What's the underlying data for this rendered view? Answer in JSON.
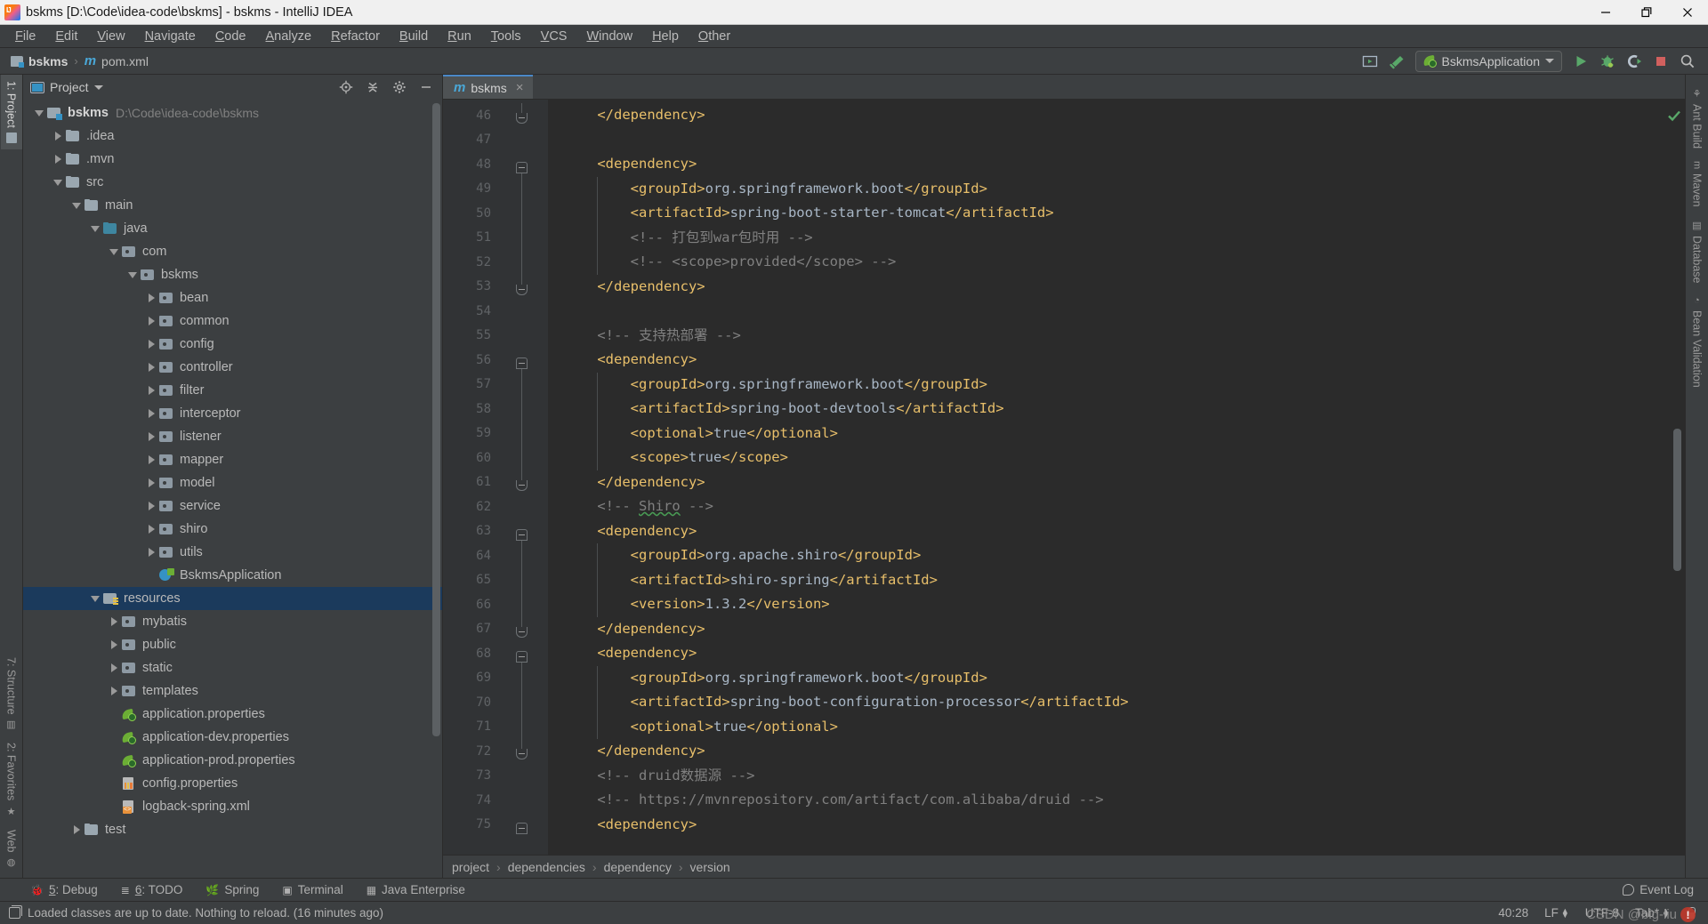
{
  "window": {
    "title": "bskms [D:\\Code\\idea-code\\bskms] - bskms - IntelliJ IDEA",
    "app_icon": "intellij-idea-icon",
    "minimize": "minimize-icon",
    "maximize": "restore-icon",
    "close": "close-icon"
  },
  "menubar": {
    "items": [
      {
        "label": "File"
      },
      {
        "label": "Edit"
      },
      {
        "label": "View"
      },
      {
        "label": "Navigate"
      },
      {
        "label": "Code"
      },
      {
        "label": "Analyze"
      },
      {
        "label": "Refactor"
      },
      {
        "label": "Build"
      },
      {
        "label": "Run"
      },
      {
        "label": "Tools"
      },
      {
        "label": "VCS"
      },
      {
        "label": "Window"
      },
      {
        "label": "Help"
      },
      {
        "label": "Other"
      }
    ]
  },
  "navbar": {
    "crumbs": [
      {
        "label": "bskms",
        "icon": "module-folder-icon"
      },
      {
        "label": "pom.xml",
        "icon": "maven-m-icon"
      }
    ],
    "separator": "›",
    "right_tools": [
      {
        "name": "run-anything-icon",
        "title": "Run Anything"
      },
      {
        "name": "hammer-build-icon",
        "title": "Build Project"
      }
    ],
    "run_config": {
      "label": "BskmsApplication",
      "icon": "spring-boot-leaf-icon",
      "dropdown": "chevron-down-icon"
    },
    "run_buttons": [
      {
        "name": "run-button",
        "glyph": "▶",
        "color": "#59a869"
      },
      {
        "name": "debug-button",
        "glyph": "bug",
        "color": "#59a869"
      },
      {
        "name": "run-coverage-button",
        "glyph": "coverage",
        "color": "#a9b7c6"
      },
      {
        "name": "stop-button",
        "glyph": "■",
        "color": "#d1605e"
      }
    ],
    "search_icon": "magnifier-icon"
  },
  "left_rail": {
    "top": [
      {
        "label": "1: Project",
        "icon": "project-folder-icon",
        "active": true
      }
    ],
    "bottom": [
      {
        "label": "7: Structure",
        "icon": "structure-icon"
      },
      {
        "label": "2: Favorites",
        "icon": "star-icon"
      },
      {
        "label": "Web",
        "icon": "web-globe-icon"
      }
    ]
  },
  "right_rail": {
    "items": [
      {
        "label": "Ant Build",
        "icon": "ant-icon"
      },
      {
        "label": "Maven",
        "icon": "maven-m-icon"
      },
      {
        "label": "Database",
        "icon": "database-icon"
      },
      {
        "label": "Bean Validation",
        "icon": "bean-validation-icon"
      }
    ]
  },
  "project_panel": {
    "title": "Project",
    "title_dropdown": "chevron-down-icon",
    "toolbar": [
      {
        "name": "locate-target-icon"
      },
      {
        "name": "collapse-all-icon"
      },
      {
        "name": "settings-gear-icon"
      },
      {
        "name": "hide-panel-icon"
      }
    ],
    "tree": [
      {
        "label": "bskms",
        "path": "D:\\Code\\idea-code\\bskms",
        "indent": 0,
        "arrow": "open",
        "icon": "module",
        "bold": true
      },
      {
        "label": ".idea",
        "indent": 1,
        "arrow": "closed",
        "icon": "folder"
      },
      {
        "label": ".mvn",
        "indent": 1,
        "arrow": "closed",
        "icon": "folder"
      },
      {
        "label": "src",
        "indent": 1,
        "arrow": "open",
        "icon": "folder"
      },
      {
        "label": "main",
        "indent": 2,
        "arrow": "open",
        "icon": "folder"
      },
      {
        "label": "java",
        "indent": 3,
        "arrow": "open",
        "icon": "folder-src"
      },
      {
        "label": "com",
        "indent": 4,
        "arrow": "open",
        "icon": "pkg"
      },
      {
        "label": "bskms",
        "indent": 5,
        "arrow": "open",
        "icon": "pkg"
      },
      {
        "label": "bean",
        "indent": 6,
        "arrow": "closed",
        "icon": "pkg"
      },
      {
        "label": "common",
        "indent": 6,
        "arrow": "closed",
        "icon": "pkg"
      },
      {
        "label": "config",
        "indent": 6,
        "arrow": "closed",
        "icon": "pkg"
      },
      {
        "label": "controller",
        "indent": 6,
        "arrow": "closed",
        "icon": "pkg"
      },
      {
        "label": "filter",
        "indent": 6,
        "arrow": "closed",
        "icon": "pkg"
      },
      {
        "label": "interceptor",
        "indent": 6,
        "arrow": "closed",
        "icon": "pkg"
      },
      {
        "label": "listener",
        "indent": 6,
        "arrow": "closed",
        "icon": "pkg"
      },
      {
        "label": "mapper",
        "indent": 6,
        "arrow": "closed",
        "icon": "pkg"
      },
      {
        "label": "model",
        "indent": 6,
        "arrow": "closed",
        "icon": "pkg"
      },
      {
        "label": "service",
        "indent": 6,
        "arrow": "closed",
        "icon": "pkg"
      },
      {
        "label": "shiro",
        "indent": 6,
        "arrow": "closed",
        "icon": "pkg"
      },
      {
        "label": "utils",
        "indent": 6,
        "arrow": "closed",
        "icon": "pkg"
      },
      {
        "label": "BskmsApplication",
        "indent": 6,
        "arrow": "none",
        "icon": "springclass"
      },
      {
        "label": "resources",
        "indent": 3,
        "arrow": "open",
        "icon": "res",
        "selected": true
      },
      {
        "label": "mybatis",
        "indent": 4,
        "arrow": "closed",
        "icon": "pkg"
      },
      {
        "label": "public",
        "indent": 4,
        "arrow": "closed",
        "icon": "pkg"
      },
      {
        "label": "static",
        "indent": 4,
        "arrow": "closed",
        "icon": "pkg"
      },
      {
        "label": "templates",
        "indent": 4,
        "arrow": "closed",
        "icon": "pkg"
      },
      {
        "label": "application.properties",
        "indent": 4,
        "arrow": "none",
        "icon": "spring"
      },
      {
        "label": "application-dev.properties",
        "indent": 4,
        "arrow": "none",
        "icon": "spring"
      },
      {
        "label": "application-prod.properties",
        "indent": 4,
        "arrow": "none",
        "icon": "spring"
      },
      {
        "label": "config.properties",
        "indent": 4,
        "arrow": "none",
        "icon": "props"
      },
      {
        "label": "logback-spring.xml",
        "indent": 4,
        "arrow": "none",
        "icon": "xml"
      },
      {
        "label": "test",
        "indent": 2,
        "arrow": "closed",
        "icon": "folder"
      }
    ]
  },
  "editor": {
    "tab": {
      "label": "bskms",
      "icon": "maven-m-icon",
      "close": "close-icon"
    },
    "first_line_number": 46,
    "lines": [
      {
        "n": 46,
        "fold": "bot",
        "segments": [
          {
            "t": "tag",
            "s": "    </dependency>"
          }
        ]
      },
      {
        "n": 47,
        "segments": []
      },
      {
        "n": 48,
        "fold": "top",
        "segments": [
          {
            "t": "tag",
            "s": "    <dependency>"
          }
        ]
      },
      {
        "n": 49,
        "segments": [
          {
            "t": "tag",
            "s": "        <groupId>"
          },
          {
            "t": "txt",
            "s": "org.springframework.boot"
          },
          {
            "t": "tag",
            "s": "</groupId>"
          }
        ]
      },
      {
        "n": 50,
        "segments": [
          {
            "t": "tag",
            "s": "        <artifactId>"
          },
          {
            "t": "txt",
            "s": "spring-boot-starter-tomcat"
          },
          {
            "t": "tag",
            "s": "</artifactId>"
          }
        ]
      },
      {
        "n": 51,
        "segments": [
          {
            "t": "cmt",
            "s": "        <!-- 打包到war包时用 -->"
          }
        ]
      },
      {
        "n": 52,
        "segments": [
          {
            "t": "cmt",
            "s": "        <!-- <scope>provided</scope> -->"
          }
        ]
      },
      {
        "n": 53,
        "fold": "bot",
        "segments": [
          {
            "t": "tag",
            "s": "    </dependency>"
          }
        ]
      },
      {
        "n": 54,
        "segments": []
      },
      {
        "n": 55,
        "segments": [
          {
            "t": "cmt",
            "s": "    <!-- 支持热部署 -->"
          }
        ]
      },
      {
        "n": 56,
        "fold": "top",
        "segments": [
          {
            "t": "tag",
            "s": "    <dependency>"
          }
        ]
      },
      {
        "n": 57,
        "segments": [
          {
            "t": "tag",
            "s": "        <groupId>"
          },
          {
            "t": "txt",
            "s": "org.springframework.boot"
          },
          {
            "t": "tag",
            "s": "</groupId>"
          }
        ]
      },
      {
        "n": 58,
        "segments": [
          {
            "t": "tag",
            "s": "        <artifactId>"
          },
          {
            "t": "txt",
            "s": "spring-boot-devtools"
          },
          {
            "t": "tag",
            "s": "</artifactId>"
          }
        ]
      },
      {
        "n": 59,
        "segments": [
          {
            "t": "tag",
            "s": "        <optional>"
          },
          {
            "t": "txt",
            "s": "true"
          },
          {
            "t": "tag",
            "s": "</optional>"
          }
        ]
      },
      {
        "n": 60,
        "segments": [
          {
            "t": "tag",
            "s": "        <scope>"
          },
          {
            "t": "txt",
            "s": "true"
          },
          {
            "t": "tag",
            "s": "</scope>"
          }
        ]
      },
      {
        "n": 61,
        "fold": "bot",
        "segments": [
          {
            "t": "tag",
            "s": "    </dependency>"
          }
        ]
      },
      {
        "n": 62,
        "segments": [
          {
            "t": "cmt",
            "s": "    <!-- "
          },
          {
            "t": "typo",
            "s": "Shiro"
          },
          {
            "t": "cmt",
            "s": " -->"
          }
        ]
      },
      {
        "n": 63,
        "fold": "top",
        "segments": [
          {
            "t": "tag",
            "s": "    <dependency>"
          }
        ]
      },
      {
        "n": 64,
        "segments": [
          {
            "t": "tag",
            "s": "        <groupId>"
          },
          {
            "t": "txt",
            "s": "org.apache.shiro"
          },
          {
            "t": "tag",
            "s": "</groupId>"
          }
        ]
      },
      {
        "n": 65,
        "segments": [
          {
            "t": "tag",
            "s": "        <artifactId>"
          },
          {
            "t": "txt",
            "s": "shiro-spring"
          },
          {
            "t": "tag",
            "s": "</artifactId>"
          }
        ]
      },
      {
        "n": 66,
        "segments": [
          {
            "t": "tag",
            "s": "        <version>"
          },
          {
            "t": "txt",
            "s": "1.3.2"
          },
          {
            "t": "tag",
            "s": "</version>"
          }
        ]
      },
      {
        "n": 67,
        "fold": "bot",
        "segments": [
          {
            "t": "tag",
            "s": "    </dependency>"
          }
        ]
      },
      {
        "n": 68,
        "fold": "top",
        "segments": [
          {
            "t": "tag",
            "s": "    <dependency>"
          }
        ]
      },
      {
        "n": 69,
        "segments": [
          {
            "t": "tag",
            "s": "        <groupId>"
          },
          {
            "t": "txt",
            "s": "org.springframework.boot"
          },
          {
            "t": "tag",
            "s": "</groupId>"
          }
        ]
      },
      {
        "n": 70,
        "segments": [
          {
            "t": "tag",
            "s": "        <artifactId>"
          },
          {
            "t": "txt",
            "s": "spring-boot-configuration-processor"
          },
          {
            "t": "tag",
            "s": "</artifactId>"
          }
        ]
      },
      {
        "n": 71,
        "segments": [
          {
            "t": "tag",
            "s": "        <optional>"
          },
          {
            "t": "txt",
            "s": "true"
          },
          {
            "t": "tag",
            "s": "</optional>"
          }
        ]
      },
      {
        "n": 72,
        "fold": "bot",
        "segments": [
          {
            "t": "tag",
            "s": "    </dependency>"
          }
        ]
      },
      {
        "n": 73,
        "segments": [
          {
            "t": "cmt",
            "s": "    <!-- druid数据源 -->"
          }
        ]
      },
      {
        "n": 74,
        "segments": [
          {
            "t": "cmt",
            "s": "    <!-- https://mvnrepository.com/artifact/com.alibaba/druid -->"
          }
        ]
      },
      {
        "n": 75,
        "fold": "top",
        "segments": [
          {
            "t": "tag",
            "s": "    <dependency>"
          }
        ]
      }
    ],
    "inspection_status": {
      "icon": "inspection-ok-check-icon",
      "color": "#59a869"
    }
  },
  "breadcrumb": {
    "items": [
      "project",
      "dependencies",
      "dependency",
      "version"
    ],
    "separator": "›"
  },
  "bottom_bar": {
    "items": [
      {
        "label": "5: Debug",
        "mnemonic": "5",
        "icon": "bug-icon"
      },
      {
        "label": "6: TODO",
        "mnemonic": "6",
        "icon": "todo-list-icon"
      },
      {
        "label": "Spring",
        "icon": "spring-leaf-icon"
      },
      {
        "label": "Terminal",
        "icon": "terminal-icon"
      },
      {
        "label": "Java Enterprise",
        "icon": "java-enterprise-icon"
      }
    ],
    "event_log": {
      "label": "Event Log",
      "icon": "event-log-icon"
    }
  },
  "statusbar": {
    "message": "Loaded classes are up to date. Nothing to reload. (16 minutes ago)",
    "message_icon": "copy-icon",
    "caret_position": "40:28",
    "line_separator": "LF",
    "encoding": "UTF-8",
    "indent": "Tab*",
    "lock_icon": "lock-icon"
  },
  "watermark": {
    "text": "CSDN @big-liu",
    "badge": "!"
  },
  "colors": {
    "accent": "#4a88c7",
    "editor_bg": "#2b2b2b",
    "panel_bg": "#3c3f41",
    "gutter_bg": "#313335",
    "tag": "#e8bf6a",
    "text": "#a9b7c6",
    "comment": "#808080",
    "selection": "#1b3a5c",
    "run_green": "#59a869",
    "stop_red": "#d1605e"
  }
}
